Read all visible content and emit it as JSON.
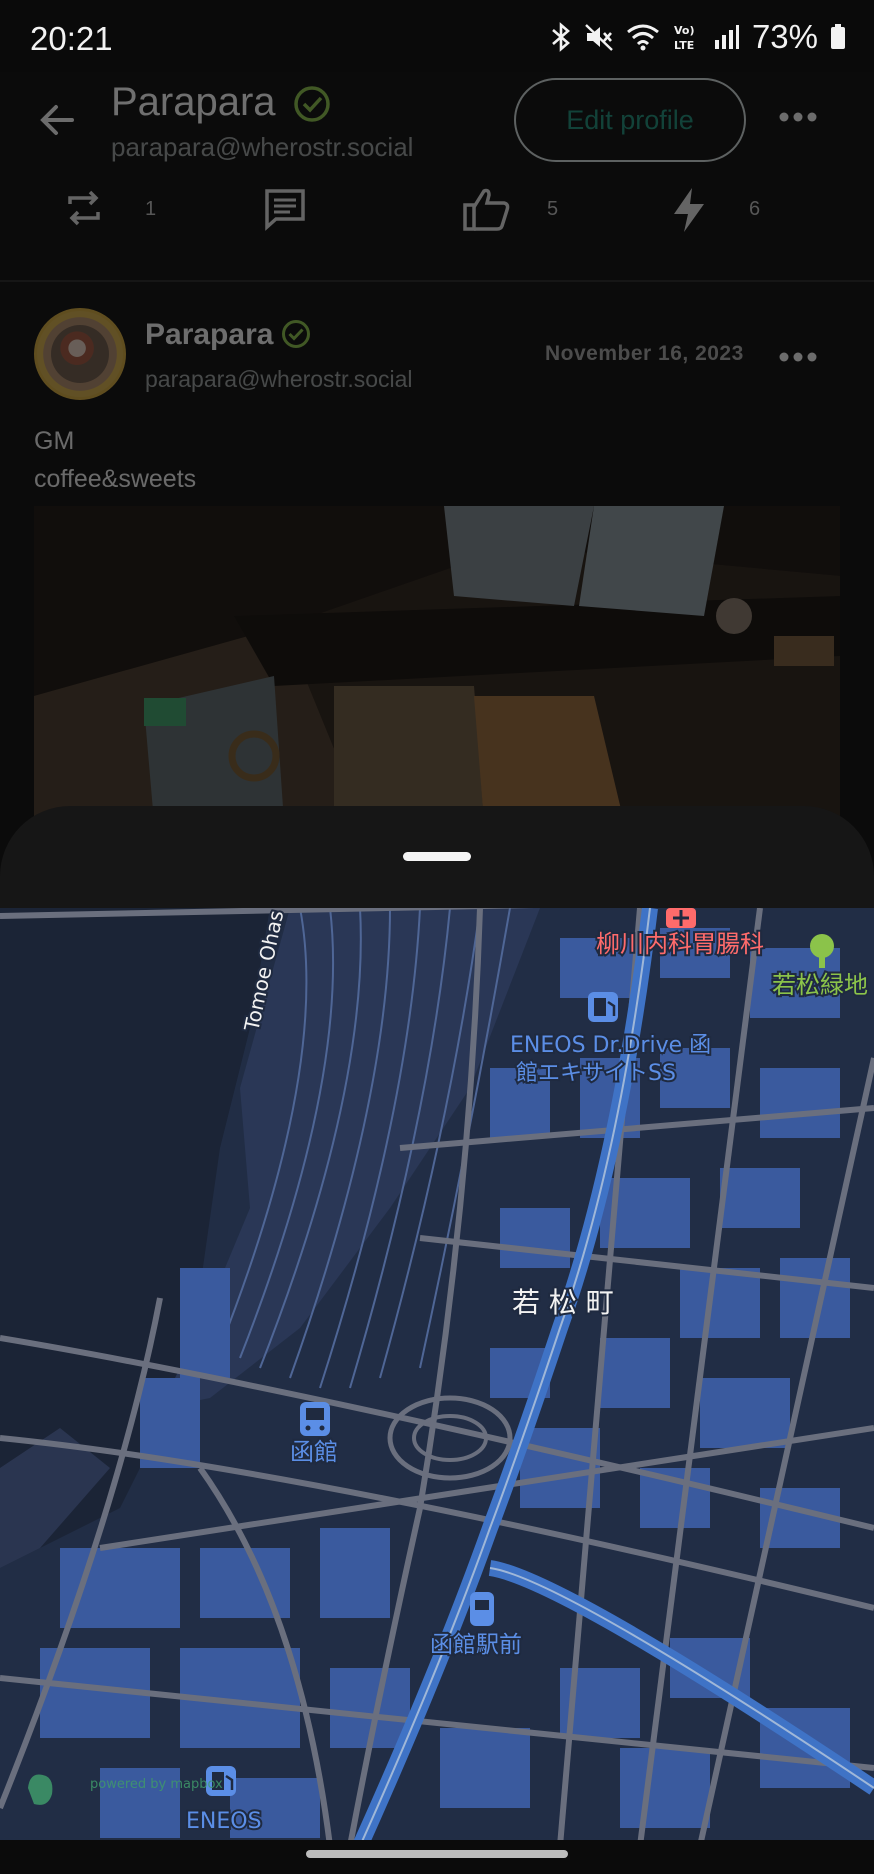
{
  "status_bar": {
    "time": "20:21",
    "battery": "73%",
    "icons": [
      "bluetooth-icon",
      "mute-icon",
      "wifi-icon",
      "volte-icon",
      "signal-icon",
      "battery-icon"
    ]
  },
  "header": {
    "name": "Parapara",
    "handle": "parapara@wherostr.social",
    "edit_button": "Edit profile"
  },
  "stats": {
    "reposts": "1",
    "likes": "5",
    "zaps": "6"
  },
  "post": {
    "author": "Parapara",
    "handle": "parapara@wherostr.social",
    "date": "November 16, 2023",
    "body": "GM\ncoffee&sweets"
  },
  "map": {
    "labels": {
      "clinic": "柳川内科胃腸科",
      "park": "若松緑地",
      "gas_station": "ENEOS Dr.Drive 函\n館エキサイトSS",
      "district": "若 松 町",
      "station": "函館",
      "tram_stop": "函館駅前",
      "gas_station_2": "ENEOS",
      "street": "Tomoe Ohas"
    },
    "attribution": "powered by mapbox"
  },
  "colors": {
    "accent": "#1d8f79",
    "verified": "#8bc34a",
    "map_base": "#1f2a40",
    "map_building": "#3a5aa0",
    "map_water": "#1c2538",
    "map_road": "#6c7180",
    "poi_blue": "#5b8ee6",
    "poi_red": "#ff6b6b",
    "poi_green": "#8bc34a"
  }
}
